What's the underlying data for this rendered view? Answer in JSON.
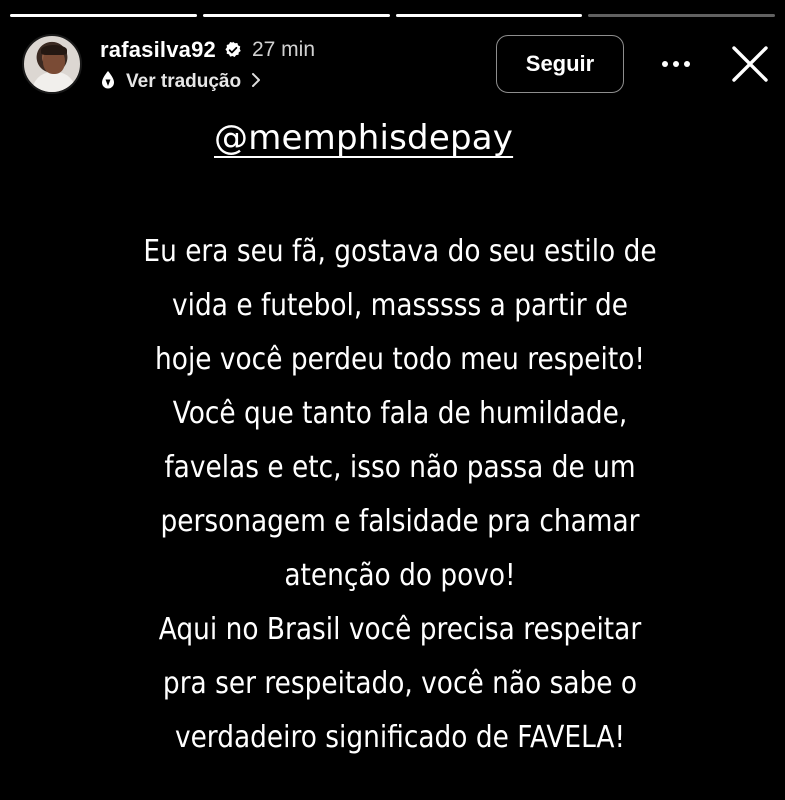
{
  "story": {
    "progress": [
      1,
      1,
      1,
      0
    ]
  },
  "header": {
    "username": "rafasilva92",
    "verified": true,
    "time": "27 min",
    "translate_label": "Ver tradução",
    "follow_label": "Seguir",
    "more_label": "•••",
    "icons": {
      "verified": "verified-badge-icon",
      "translate": "translate-icon",
      "chevron": "chevron-right-icon",
      "more": "more-options-icon",
      "close": "close-icon"
    }
  },
  "content": {
    "mention": "@memphisdepay",
    "lines": [
      "Eu era  seu fã, gostava do seu estilo de",
      "vida e futebol, masssss a partir de",
      "hoje você perdeu todo meu respeito!",
      "Você que tanto fala de humildade,",
      "favelas e etc,  isso não passa de um",
      "personagem e falsidade pra chamar",
      "atenção do povo!",
      "Aqui no Brasil você precisa respeitar",
      "pra ser respeitado, você não sabe o",
      "verdadeiro significado de FAVELA!"
    ],
    "divider": "_________________________"
  }
}
